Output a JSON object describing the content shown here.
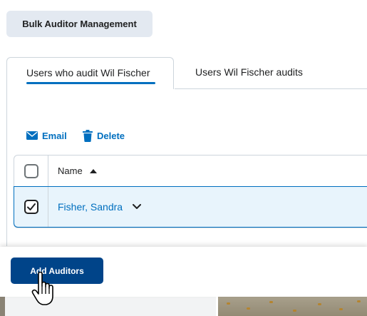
{
  "bulk_button_label": "Bulk Auditor Management",
  "tabs": [
    {
      "label": "Users who audit Wil Fischer",
      "selected": true
    },
    {
      "label": "Users Wil Fischer audits",
      "selected": false
    }
  ],
  "actions": {
    "email_label": "Email",
    "delete_label": "Delete"
  },
  "table": {
    "name_header": "Name",
    "sort": "ascending",
    "rows": [
      {
        "name": "Fisher, Sandra",
        "checked": true
      }
    ]
  },
  "footer": {
    "add_button_label": "Add Auditors"
  },
  "colors": {
    "accent": "#006fbf",
    "primary_button": "#004489",
    "selected_row": "#e8f4fc"
  }
}
